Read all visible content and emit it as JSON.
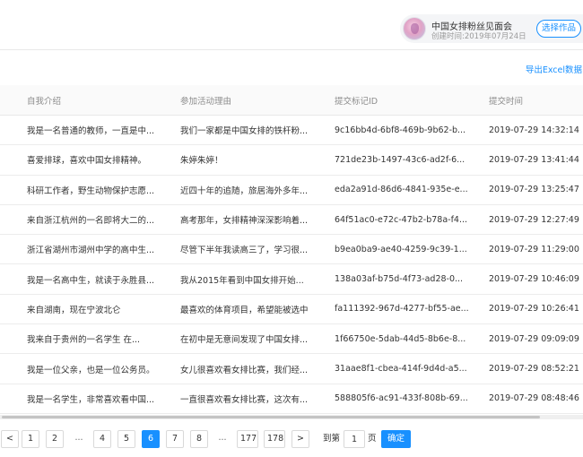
{
  "event": {
    "title": "中国女排粉丝见面会",
    "created": "创建时间:2019年07月24日",
    "choose_label": "选择作品"
  },
  "toolbar": {
    "export_label": "导出Excel数据"
  },
  "table": {
    "columns": [
      "自我介绍",
      "参加活动理由",
      "提交标记ID",
      "提交时间"
    ],
    "rows": [
      {
        "intro": "我是一名普通的教师，一直是中...",
        "reason": "我们一家都是中国女排的铁杆粉...",
        "id": "9c16bb4d-6bf8-469b-9b62-b...",
        "time": "2019-07-29 14:32:14"
      },
      {
        "intro": "喜爱排球，喜欢中国女排精神。",
        "reason": "朱婷朱婷！",
        "id": "721de23b-1497-43c6-ad2f-6...",
        "time": "2019-07-29 13:41:44"
      },
      {
        "intro": "科研工作者，野生动物保护志愿...",
        "reason": "近四十年的追随，旅居海外多年...",
        "id": "eda2a91d-86d6-4841-935e-e...",
        "time": "2019-07-29 13:25:47"
      },
      {
        "intro": "来自浙江杭州的一名即将大二的...",
        "reason": "高考那年，女排精神深深影响着...",
        "id": "64f51ac0-e72c-47b2-b78a-f4...",
        "time": "2019-07-29 12:27:49"
      },
      {
        "intro": "浙江省湖州市湖州中学的高中生...",
        "reason": "尽管下半年我读高三了，学习很...",
        "id": "b9ea0ba9-ae40-4259-9c39-1...",
        "time": "2019-07-29 11:29:00"
      },
      {
        "intro": "我是一名高中生，就读于永胜县...",
        "reason": "我从2015年看到中国女排开始...",
        "id": "138a03af-b75d-4f73-ad28-0...",
        "time": "2019-07-29 10:46:09"
      },
      {
        "intro": "来自湖南，现在宁波北仑",
        "reason": "最喜欢的体育项目，希望能被选中",
        "id": "fa111392-967d-4277-bf55-ae...",
        "time": "2019-07-29 10:26:41"
      },
      {
        "intro": "我来自于贵州的一名学生 在...",
        "reason": "在初中是无意间发现了中国女排...",
        "id": "1f66750e-5dab-44d5-8b6e-8...",
        "time": "2019-07-29 09:09:09"
      },
      {
        "intro": "我是一位父亲，也是一位公务员。",
        "reason": "女儿很喜欢看女排比赛，我们经...",
        "id": "31aae8f1-cbea-414f-9d4d-a5...",
        "time": "2019-07-29 08:52:21"
      },
      {
        "intro": "我是一名学生，非常喜欢看中国...",
        "reason": "一直很喜欢看女排比赛，这次有...",
        "id": "588805f6-ac91-433f-808b-69...",
        "time": "2019-07-29 08:48:46"
      }
    ]
  },
  "pagination": {
    "prev": "<",
    "next": ">",
    "ellipsis": "...",
    "pages": [
      "1",
      "2",
      "4",
      "5",
      "6",
      "7",
      "8",
      "177",
      "178"
    ],
    "current": "6",
    "goto_prefix": "到第",
    "goto_value": "1",
    "goto_suffix": "页",
    "confirm_label": "确定"
  }
}
